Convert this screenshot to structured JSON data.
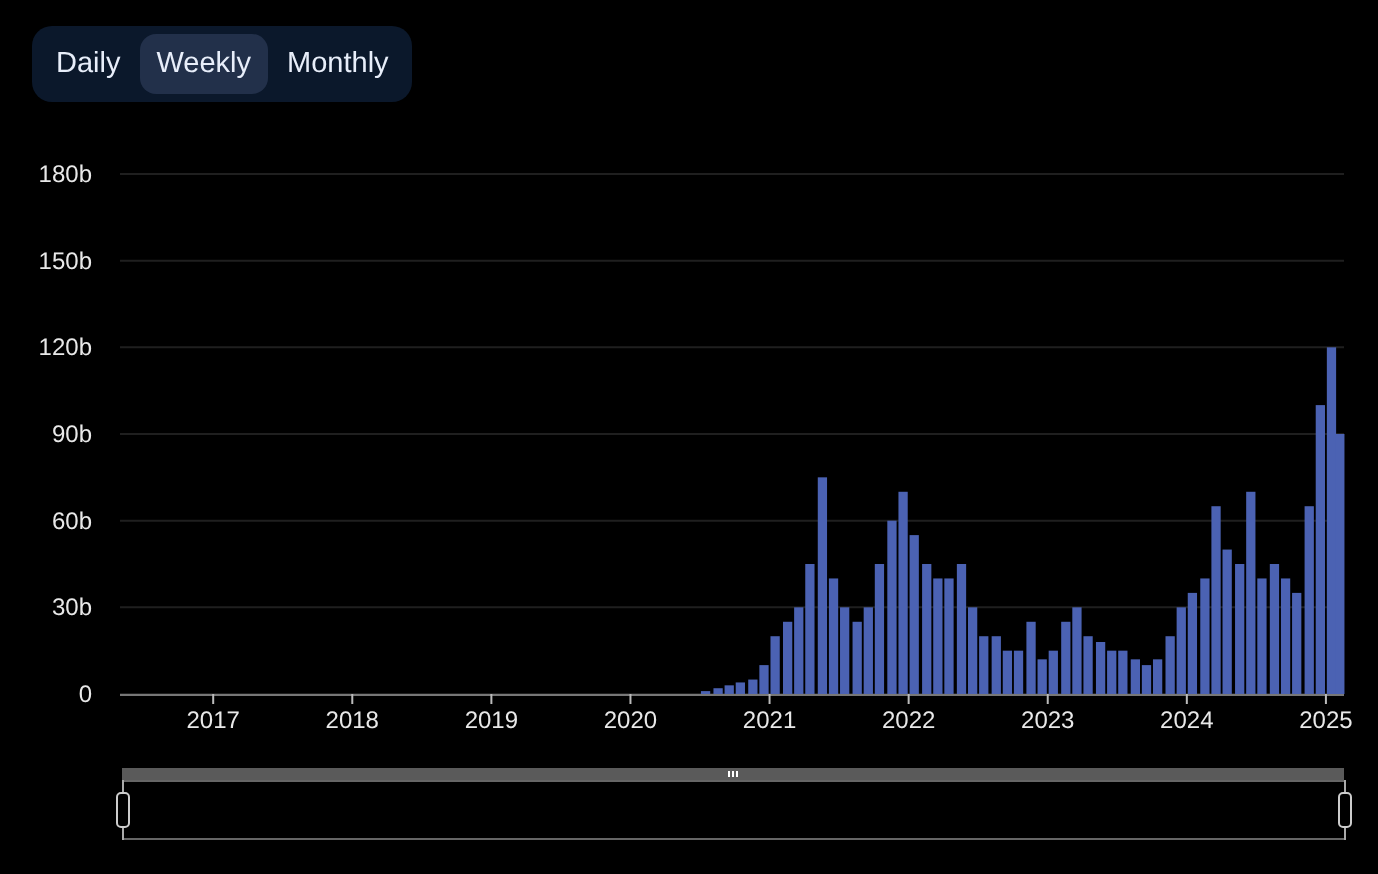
{
  "tabs": [
    {
      "label": "Daily",
      "selected": false
    },
    {
      "label": "Weekly",
      "selected": true
    },
    {
      "label": "Monthly",
      "selected": false
    }
  ],
  "chart": {
    "chart_data": {
      "type": "bar",
      "grid": true,
      "xlim": [
        2016.33,
        2025.13
      ],
      "ylim": [
        0,
        180
      ],
      "xticks": [
        {
          "value": 2017,
          "label": "2017"
        },
        {
          "value": 2018,
          "label": "2018"
        },
        {
          "value": 2019,
          "label": "2019"
        },
        {
          "value": 2020,
          "label": "2020"
        },
        {
          "value": 2021,
          "label": "2021"
        },
        {
          "value": 2022,
          "label": "2022"
        },
        {
          "value": 2023,
          "label": "2023"
        },
        {
          "value": 2024,
          "label": "2024"
        },
        {
          "value": 2025,
          "label": "2025"
        }
      ],
      "yticks": [
        {
          "value": 0,
          "label": "0"
        },
        {
          "value": 30,
          "label": "30b"
        },
        {
          "value": 60,
          "label": "60b"
        },
        {
          "value": 90,
          "label": "90b"
        },
        {
          "value": 120,
          "label": "120b"
        },
        {
          "value": 150,
          "label": "150b"
        },
        {
          "value": 180,
          "label": "180b"
        }
      ],
      "x": [
        2020.54,
        2020.63,
        2020.71,
        2020.79,
        2020.88,
        2020.96,
        2021.04,
        2021.13,
        2021.21,
        2021.29,
        2021.38,
        2021.46,
        2021.54,
        2021.63,
        2021.71,
        2021.79,
        2021.88,
        2021.96,
        2022.04,
        2022.13,
        2022.21,
        2022.29,
        2022.38,
        2022.46,
        2022.54,
        2022.63,
        2022.71,
        2022.79,
        2022.88,
        2022.96,
        2023.04,
        2023.13,
        2023.21,
        2023.29,
        2023.38,
        2023.46,
        2023.54,
        2023.63,
        2023.71,
        2023.79,
        2023.88,
        2023.96,
        2024.04,
        2024.13,
        2024.21,
        2024.29,
        2024.38,
        2024.46,
        2024.54,
        2024.63,
        2024.71,
        2024.79,
        2024.88,
        2024.96,
        2025.04,
        2025.1
      ],
      "series": [
        {
          "color": "#4b62b3",
          "values": [
            1,
            2,
            3,
            4,
            5,
            10,
            20,
            25,
            30,
            45,
            75,
            40,
            30,
            25,
            30,
            45,
            60,
            70,
            55,
            45,
            40,
            40,
            45,
            30,
            20,
            20,
            15,
            15,
            25,
            12,
            15,
            25,
            30,
            20,
            18,
            15,
            15,
            12,
            10,
            12,
            20,
            30,
            35,
            40,
            65,
            50,
            45,
            70,
            40,
            45,
            40,
            35,
            65,
            100,
            120,
            90
          ]
        }
      ]
    }
  },
  "slider": {
    "kind": "range"
  }
}
